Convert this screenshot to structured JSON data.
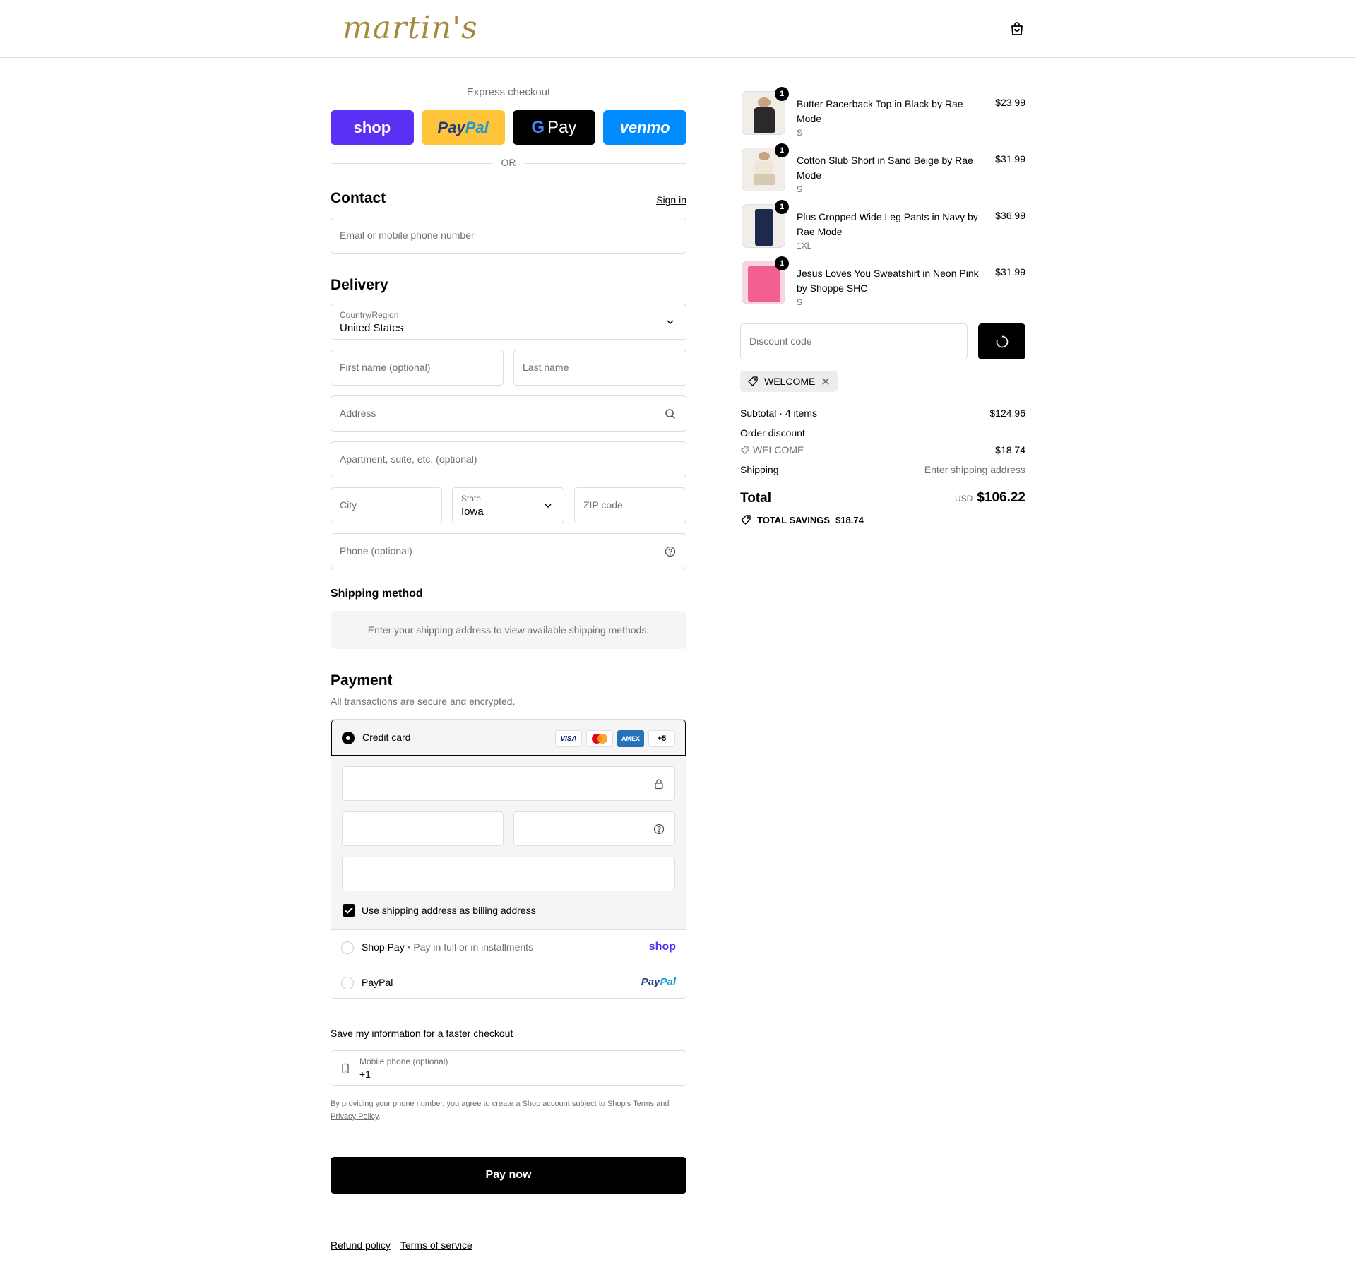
{
  "header": {
    "logo_text": "martin's",
    "cart_icon": "bag-icon"
  },
  "express": {
    "title": "Express checkout",
    "buttons": {
      "shop": "shop",
      "paypal_a": "Pay",
      "paypal_b": "Pal",
      "gpay_g": "G",
      "gpay": "Pay",
      "venmo": "venmo"
    },
    "or": "OR"
  },
  "contact": {
    "title": "Contact",
    "sign_in": "Sign in",
    "email_placeholder": "Email or mobile phone number"
  },
  "delivery": {
    "title": "Delivery",
    "country_label": "Country/Region",
    "country_value": "United States",
    "first_name_placeholder": "First name (optional)",
    "last_name_placeholder": "Last name",
    "address_placeholder": "Address",
    "apartment_placeholder": "Apartment, suite, etc. (optional)",
    "city_placeholder": "City",
    "state_label": "State",
    "state_value": "Iowa",
    "zip_placeholder": "ZIP code",
    "phone_placeholder": "Phone (optional)"
  },
  "shipping_method": {
    "title": "Shipping method",
    "note": "Enter your shipping address to view available shipping methods."
  },
  "payment": {
    "title": "Payment",
    "subtitle": "All transactions are secure and encrypted.",
    "credit_card_label": "Credit card",
    "cards": {
      "visa": "VISA",
      "amex": "AMEX",
      "more": "+5"
    },
    "billing_checkbox_label": "Use shipping address as billing address",
    "shop_pay_label": "Shop Pay",
    "shop_pay_sub": "Pay in full or in installments",
    "shop_pay_brand": "shop",
    "paypal_label": "PayPal",
    "paypal_brand_a": "Pay",
    "paypal_brand_b": "Pal"
  },
  "save_info": {
    "title": "Save my information for a faster checkout",
    "mobile_label": "Mobile phone (optional)",
    "mobile_value": "+1",
    "terms_text": "By providing your phone number, you agree to create a Shop account subject to Shop's",
    "terms_link": "Terms",
    "and_text": "and",
    "privacy_link": "Privacy Policy",
    "period": "."
  },
  "pay_now": "Pay now",
  "footer": {
    "refund": "Refund policy",
    "tos": "Terms of service"
  },
  "cart": {
    "items": [
      {
        "qty": "1",
        "name": "Butter Racerback Top in Black by Rae Mode",
        "variant": "S",
        "price": "$23.99",
        "color": "#2a2a2a"
      },
      {
        "qty": "1",
        "name": "Cotton Slub Short in Sand Beige by Rae Mode",
        "variant": "S",
        "price": "$31.99",
        "color": "#d8c9b3"
      },
      {
        "qty": "1",
        "name": "Plus Cropped Wide Leg Pants in Navy by Rae Mode",
        "variant": "1XL",
        "price": "$36.99",
        "color": "#1d2a4d"
      },
      {
        "qty": "1",
        "name": "Jesus Loves You Sweatshirt in Neon Pink by Shoppe SHC",
        "variant": "S",
        "price": "$31.99",
        "color": "#f2608f"
      }
    ],
    "discount_placeholder": "Discount code",
    "applied_code": "WELCOME",
    "subtotal_label": "Subtotal · 4 items",
    "subtotal_value": "$124.96",
    "order_discount_label": "Order discount",
    "discount_code": "WELCOME",
    "discount_value": "– $18.74",
    "shipping_label": "Shipping",
    "shipping_value": "Enter shipping address",
    "total_label": "Total",
    "currency": "USD",
    "total_value": "$106.22",
    "savings_label": "TOTAL SAVINGS",
    "savings_value": "$18.74"
  }
}
